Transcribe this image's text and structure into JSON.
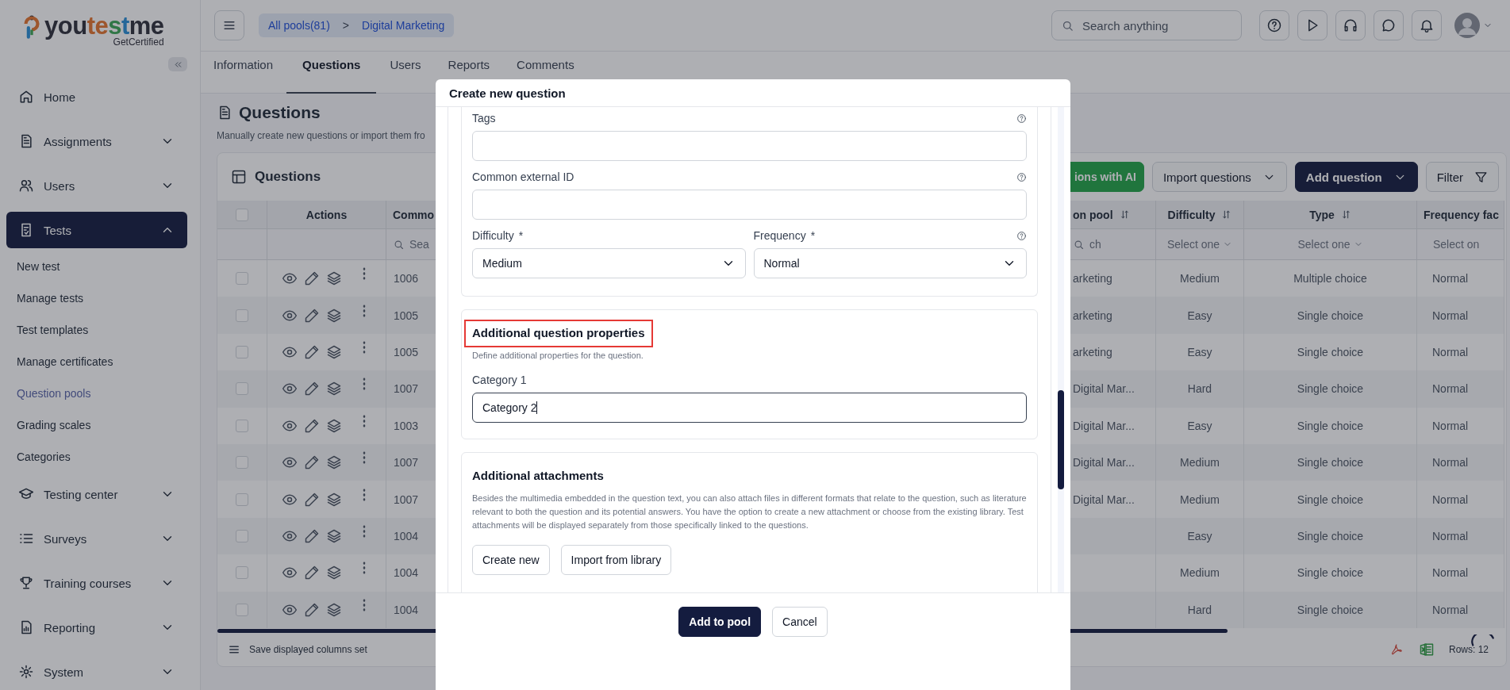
{
  "sidebar": {
    "logo": [
      "you",
      "te",
      "s",
      "t",
      "me"
    ],
    "tagline": "GetCertified",
    "items": [
      {
        "label": "Home",
        "kind": "link",
        "selected": false
      },
      {
        "label": "Assignments",
        "kind": "group",
        "selected": false,
        "expanded": false
      },
      {
        "label": "Users",
        "kind": "group",
        "selected": false,
        "expanded": false
      },
      {
        "label": "Tests",
        "kind": "group",
        "selected": true,
        "expanded": true,
        "children": [
          {
            "label": "New test",
            "selected": false
          },
          {
            "label": "Manage tests",
            "selected": false
          },
          {
            "label": "Test templates",
            "selected": false
          },
          {
            "label": "Manage certificates",
            "selected": false
          },
          {
            "label": "Question pools",
            "selected": true
          },
          {
            "label": "Grading scales",
            "selected": false
          },
          {
            "label": "Categories",
            "selected": false
          }
        ]
      },
      {
        "label": "Testing center",
        "kind": "group",
        "selected": false,
        "expanded": false
      },
      {
        "label": "Surveys",
        "kind": "group",
        "selected": false,
        "expanded": false
      },
      {
        "label": "Training courses",
        "kind": "group",
        "selected": false,
        "expanded": false
      },
      {
        "label": "Reporting",
        "kind": "group",
        "selected": false,
        "expanded": false
      },
      {
        "label": "System",
        "kind": "group",
        "selected": false,
        "expanded": false
      }
    ]
  },
  "topbar": {
    "breadcrumbs": [
      "All pools(81)",
      "Digital Marketing"
    ],
    "separator": ">",
    "search": {
      "placeholder": "Search anything"
    }
  },
  "tabs": [
    {
      "label": "Information",
      "selected": false
    },
    {
      "label": "Questions",
      "selected": true
    },
    {
      "label": "Users",
      "selected": false
    },
    {
      "label": "Reports",
      "selected": false
    },
    {
      "label": "Comments",
      "selected": false
    }
  ],
  "page": {
    "title": "Questions",
    "description": "Manually create new questions or import them fro"
  },
  "table": {
    "title": "Questions",
    "buttons": [
      {
        "label": "ions with AI",
        "kind": "ai"
      },
      {
        "label": "Import questions",
        "kind": "dropdown"
      },
      {
        "label": "Add question",
        "kind": "primary"
      },
      {
        "label": "Filter",
        "kind": "filter"
      }
    ],
    "header_checked": false,
    "columns": [
      {
        "kind": "check"
      },
      {
        "kind": "actions",
        "label": "Actions"
      },
      {
        "kind": "id",
        "label": "Commo",
        "filter": {
          "kind": "search",
          "placeholder": "Sea"
        }
      },
      {
        "kind": "spacer"
      },
      {
        "kind": "pool",
        "label": "on pool",
        "sortable": true,
        "filter": {
          "kind": "search",
          "placeholder": "ch"
        }
      },
      {
        "kind": "difficulty",
        "label": "Difficulty",
        "sortable": true,
        "filter": {
          "kind": "select",
          "text": "Select one"
        }
      },
      {
        "kind": "type",
        "label": "Type",
        "sortable": true,
        "filter": {
          "kind": "select",
          "text": "Select one"
        }
      },
      {
        "kind": "frequency",
        "label": "Frequency fac",
        "filter": {
          "kind": "text",
          "text": "Select on"
        }
      }
    ],
    "rows": [
      {
        "checked": false,
        "id": "1006",
        "pool": "arketing",
        "difficulty": "Medium",
        "type": "Multiple choice",
        "frequency": "Normal"
      },
      {
        "checked": false,
        "id": "1005",
        "pool": "arketing",
        "difficulty": "Easy",
        "type": "Single choice",
        "frequency": "Normal"
      },
      {
        "checked": false,
        "id": "1005",
        "pool": "arketing",
        "difficulty": "Easy",
        "type": "Single choice",
        "frequency": "Normal"
      },
      {
        "checked": false,
        "id": "1007",
        "pool": "Digital Mar...",
        "difficulty": "Hard",
        "type": "Single choice",
        "frequency": "Normal"
      },
      {
        "checked": false,
        "id": "1003",
        "pool": "Digital Mar...",
        "difficulty": "Easy",
        "type": "Single choice",
        "frequency": "Normal"
      },
      {
        "checked": false,
        "id": "1007",
        "pool": "Digital Mar...",
        "difficulty": "Medium",
        "type": "Single choice",
        "frequency": "Normal"
      },
      {
        "checked": false,
        "id": "1007",
        "pool": "Digital Mar...",
        "difficulty": "Medium",
        "type": "Single choice",
        "frequency": "Normal"
      },
      {
        "checked": false,
        "id": "1004",
        "difficulty": "Easy",
        "type": "Single choice",
        "frequency": "Normal"
      },
      {
        "checked": false,
        "id": "1004",
        "difficulty": "Medium",
        "type": "Single choice",
        "frequency": "Normal"
      },
      {
        "checked": false,
        "id": "1004",
        "difficulty": "Hard",
        "type": "Single choice",
        "frequency": "Normal"
      }
    ],
    "footer": {
      "save_label": "Save displayed columns set",
      "rows": "Rows: 12",
      "loading": true
    }
  },
  "modal": {
    "title": "Create new question",
    "sections": [
      {
        "fields": [
          {
            "kind": "input",
            "label": "Tags",
            "help": true
          },
          {
            "kind": "input",
            "label": "Common external ID",
            "help": true
          },
          {
            "kind": "select_pair",
            "items": [
              {
                "label": "Difficulty",
                "mark": "*",
                "value": "Medium",
                "help": false
              },
              {
                "label": "Frequency",
                "mark": "*",
                "value": "Normal",
                "help": true
              }
            ]
          }
        ]
      },
      {
        "title": "Additional question properties",
        "highlighted": true,
        "description": "Define additional properties for the question.",
        "fields": [
          {
            "kind": "input",
            "label": "Category 1",
            "value": "Category 2",
            "focused": true,
            "help": false
          }
        ]
      },
      {
        "title": "Additional attachments",
        "highlighted": false,
        "description": "Besides the multimedia embedded in the question text, you can also attach files in different formats that relate to the question, such as literature relevant to both the question and its potential answers. You have the option to create a new attachment or choose from the existing library. Test attachments will be displayed separately from those specifically linked to the questions.",
        "buttons": [
          "Create new",
          "Import from library"
        ]
      }
    ],
    "buttons": [
      {
        "label": "Add to pool",
        "kind": "primary"
      },
      {
        "label": "Cancel",
        "kind": "secondary"
      }
    ]
  }
}
